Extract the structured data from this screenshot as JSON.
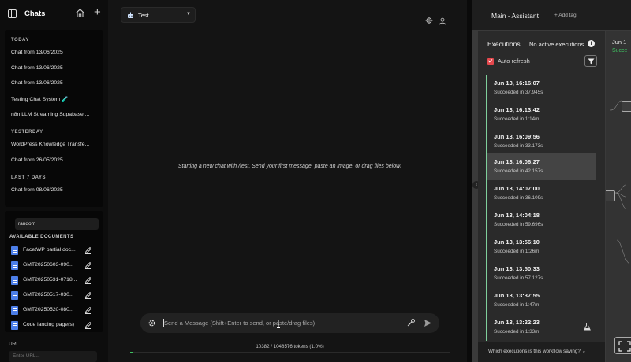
{
  "sidebar": {
    "title": "Chats",
    "sections": [
      {
        "label": "TODAY",
        "chats": [
          "Chat from 13/06/2025",
          "Chat from 13/06/2025",
          "Chat from 13/06/2025",
          "Testing Chat System 🧪",
          "n8n LLM Streaming Supabase ..."
        ]
      },
      {
        "label": "YESTERDAY",
        "chats": [
          "WordPress Knowledge Transfe...",
          "Chat from 26/05/2025"
        ]
      },
      {
        "label": "LAST 7 DAYS",
        "chats": [
          "Chat from 08/06/2025"
        ]
      }
    ],
    "docs_search_value": "random",
    "docs_heading": "AVAILABLE DOCUMENTS",
    "documents": [
      "FacetWP partial doc...",
      "GMT20250603-090...",
      "GMT20250531-0718...",
      "GMT20250517-030...",
      "GMT20250520-080...",
      "Code landing page(s)"
    ],
    "url_label": "URL",
    "url_placeholder": "Enter URL..."
  },
  "chat": {
    "model": "Test",
    "empty_message": "Starting a new chat with /test. Send your first message, paste an image, or drag files below!",
    "input_placeholder": "Send a Message (Shift+Enter to send, or paste/drag files)",
    "token_text": "10382 / 1048576 tokens (1.0%)",
    "token_fraction": 0.01
  },
  "n8n": {
    "workflow_name": "Main - Assistant",
    "add_tag": "+ Add tag",
    "executions_title": "Executions",
    "no_active": "No active executions",
    "auto_refresh_label": "Auto refresh",
    "auto_refresh_checked": true,
    "executions": [
      {
        "time": "Jun 13, 16:16:07",
        "status": "Succeeded in 37.945s"
      },
      {
        "time": "Jun 13, 16:13:42",
        "status": "Succeeded in 1:14m"
      },
      {
        "time": "Jun 13, 16:09:56",
        "status": "Succeeded in 33.173s"
      },
      {
        "time": "Jun 13, 16:06:27",
        "status": "Succeeded in 42.157s",
        "active": true
      },
      {
        "time": "Jun 13, 14:07:00",
        "status": "Succeeded in 36.109s"
      },
      {
        "time": "Jun 13, 14:04:18",
        "status": "Succeeded in 59.696s"
      },
      {
        "time": "Jun 13, 13:56:10",
        "status": "Succeeded in 1:26m"
      },
      {
        "time": "Jun 13, 13:50:33",
        "status": "Succeeded in 57.127s"
      },
      {
        "time": "Jun 13, 13:37:55",
        "status": "Succeeded in 1:47m"
      },
      {
        "time": "Jun 13, 13:22:23",
        "status": "Succeeded in 1:33m",
        "test": true
      }
    ],
    "save_question": "Which executions is this workflow saving?",
    "canvas_date": "Jun 1",
    "canvas_status": "Succe",
    "success_color": "#3ec060"
  }
}
